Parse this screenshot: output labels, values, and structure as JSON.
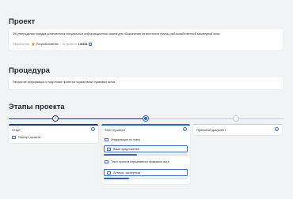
{
  "project": {
    "heading": "Проект",
    "title": "Об утверждении порядка установления специальных информационных знаков для обозначения на местности границ рыбохозяйственной заповедной зоны",
    "developer_label": "Разработчик",
    "developer": "Росрыболовство",
    "id_label": "ID проекта",
    "id_value": "146331"
  },
  "procedure": {
    "heading": "Процедура",
    "text": "Раскрытие информации о подготовке проектов нормативных правовых актов"
  },
  "stages": {
    "heading": "Этапы проекта",
    "columns": [
      {
        "title": "Старт",
        "items": [
          {
            "label": "Паспорт проекта",
            "icon": "passport-icon"
          }
        ]
      },
      {
        "title": "Текст проекта",
        "items": [
          {
            "label": "Информация по этапу",
            "icon": "list-icon"
          },
          {
            "label": "Ваши предложения",
            "icon": "comment-icon",
            "progress": 0.4
          },
          {
            "label": "Текст проекта нормативного правового акта",
            "icon": "document-icon"
          },
          {
            "label": "Антикор. экспертиза",
            "icon": "check-document-icon",
            "progress": 0.3
          }
        ]
      },
      {
        "title": "Принятый документ",
        "items": []
      }
    ],
    "steps": [
      {
        "state": "done"
      },
      {
        "state": "current"
      },
      {
        "state": "pending"
      }
    ]
  },
  "colors": {
    "accent": "#2f5fcf",
    "done": "#1f3a6e",
    "muted_track": "#c9ccd2",
    "background": "#f2f3f5"
  },
  "info_glyph": "i",
  "check_glyph": "✓"
}
